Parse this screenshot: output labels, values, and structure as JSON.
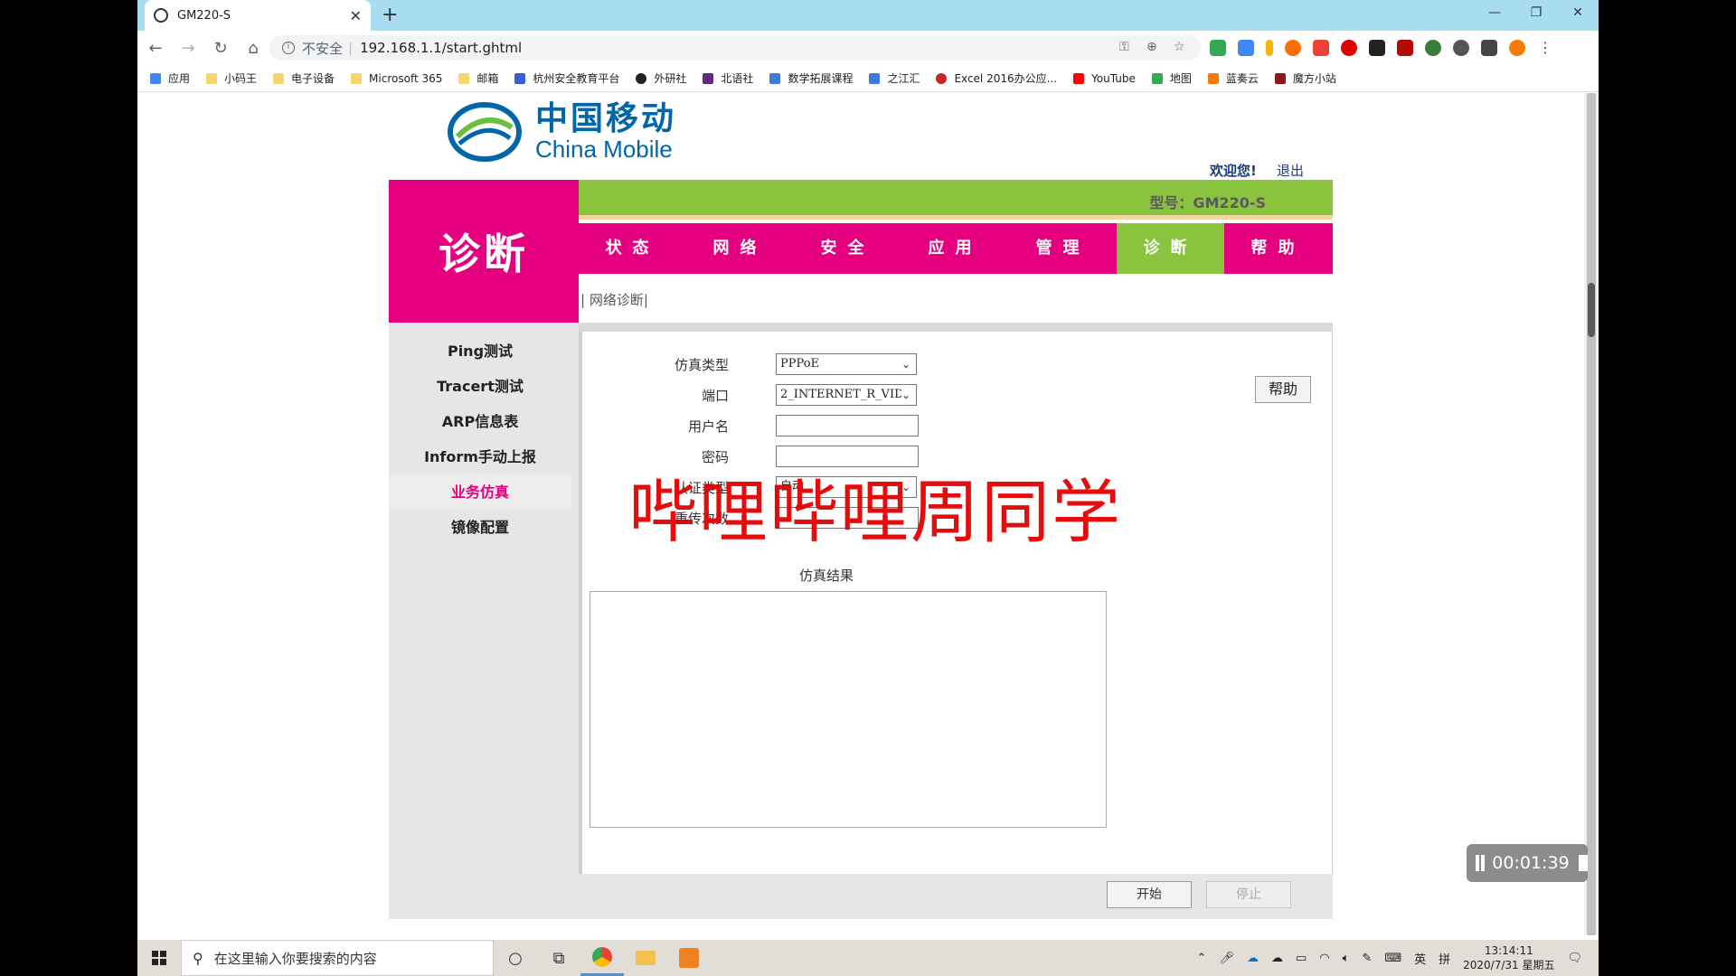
{
  "browser": {
    "tab_title": "GM220-S",
    "url": "192.168.1.1/start.ghtml",
    "insecure_label": "不安全",
    "bookmarks": [
      "应用",
      "小码王",
      "电子设备",
      "Microsoft 365",
      "邮箱",
      "杭州安全教育平台",
      "外研社",
      "北语社",
      "数学拓展课程",
      "之江汇",
      "Excel 2016办公应...",
      "YouTube",
      "地图",
      "蓝奏云",
      "魔方小站"
    ]
  },
  "header": {
    "logo_cn": "中国移动",
    "logo_en": "China Mobile",
    "welcome": "欢迎您!",
    "logout": "退出",
    "model": "型号：GM220-S"
  },
  "section_title": "诊断",
  "main_nav": [
    "状态",
    "网络",
    "安全",
    "应用",
    "管理",
    "诊断",
    "帮助"
  ],
  "sub_nav": "| 网络诊断|",
  "left_nav": [
    "Ping测试",
    "Tracert测试",
    "ARP信息表",
    "Inform手动上报",
    "业务仿真",
    "镜像配置"
  ],
  "form": {
    "sim_type_label": "仿真类型",
    "sim_type_value": "PPPoE",
    "port_label": "端口",
    "port_value": "2_INTERNET_R_VID",
    "username_label": "用户名",
    "password_label": "密码",
    "auth_type_label": "认证类型",
    "auth_type_value": "自动",
    "retry_label": "重传次数",
    "help_button": "帮助",
    "result_label": "仿真结果",
    "start_button": "开始",
    "stop_button": "停止"
  },
  "overlay": {
    "watermark": "哔哩哔哩周同学",
    "timer": "00:01:39"
  },
  "taskbar": {
    "search_placeholder": "在这里输入你要搜索的内容",
    "ime_lang": "英",
    "ime_mode": "拼",
    "time": "13:14:11",
    "date": "2020/7/31 星期五"
  },
  "colors": {
    "brand_magenta": "#e4007f",
    "brand_green": "#8ac43f",
    "brand_blue": "#0066a8"
  }
}
